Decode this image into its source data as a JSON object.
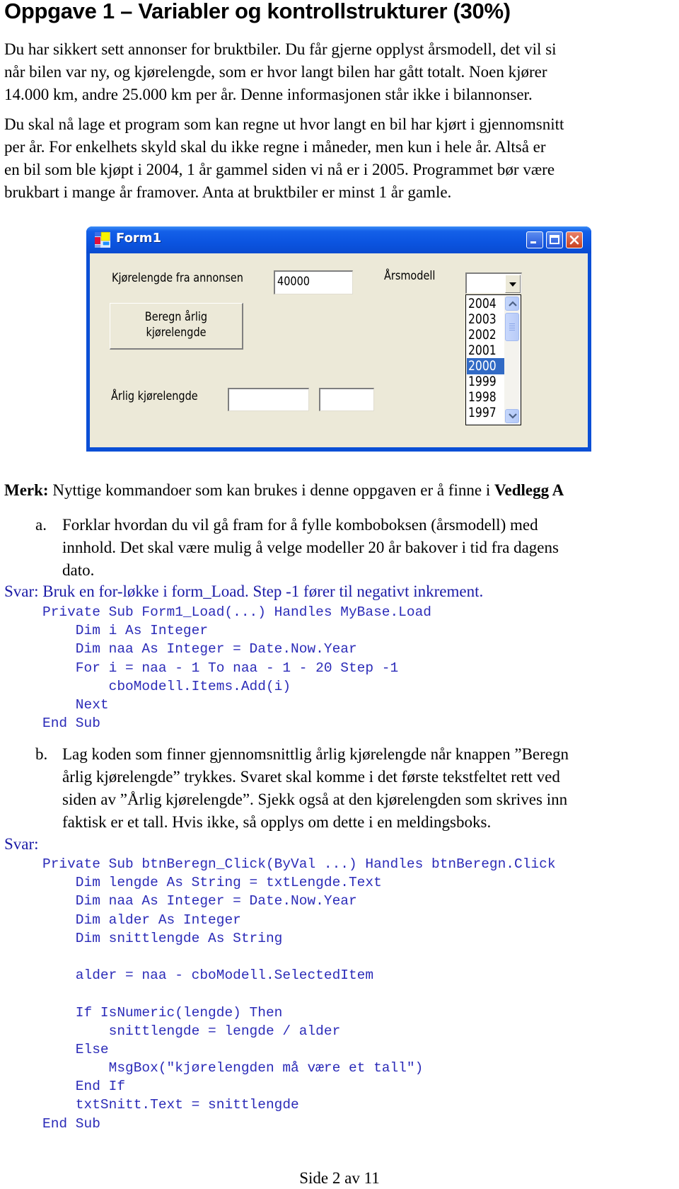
{
  "heading": "Oppgave 1 – Variabler og kontrollstrukturer (30%)",
  "intro": {
    "paragraph1": [
      "Du har sikkert sett annonser for bruktbiler. Du får gjerne opplyst årsmodell, det vil si",
      "når bilen var ny, og kjørelengde, som er hvor langt bilen har gått totalt. Noen kjører",
      "14.000 km, andre 25.000 km per år. Denne informasjonen står ikke i bilannonser."
    ],
    "paragraph2": [
      "Du skal nå lage et program som kan regne ut hvor langt en bil har kjørt i gjennomsnitt",
      "per år. For enkelhets skyld skal du ikke regne i måneder, men kun i hele år. Altså er",
      "en bil som ble kjøpt i 2004, 1 år gammel siden vi nå er i 2005. Programmet bør være",
      "brukbart i mange år framover. Anta at bruktbiler er minst 1 år gamle."
    ]
  },
  "form": {
    "title": "Form1",
    "mileage_label": "Kjørelengde fra annonsen",
    "mileage_value": "40000",
    "model_label": "Årsmodell",
    "model_combo_value": "",
    "calc_button_lines": [
      "Beregn årlig",
      "kjørelengde"
    ],
    "annual_label": "Årlig kjørelengde",
    "annual_value_1": "",
    "annual_value_2": "",
    "year_list": [
      "2004",
      "2003",
      "2002",
      "2001",
      "2000",
      "1999",
      "1998",
      "1997"
    ],
    "selected_year": "2000",
    "colors": {
      "titlebar": "#0b54e0",
      "client_bg": "#ece9d8",
      "selection": "#316ac5"
    }
  },
  "note": {
    "prefix": "Merk:",
    "text": " Nyttige kommandoer som kan brukes i denne oppgaven er å finne i ",
    "ref": "Vedlegg A"
  },
  "task_a": {
    "marker": "a.",
    "lines": [
      "Forklar hvordan du vil gå fram for å fylle komboboksen (årsmodell) med",
      "innhold. Det skal være mulig å velge modeller 20 år bakover i tid fra dagens",
      "dato."
    ],
    "answer": "Svar: Bruk en for-løkke i form_Load. Step -1 fører til negativt inkrement.",
    "code": [
      "Private Sub Form1_Load(...) Handles MyBase.Load",
      "    Dim i As Integer",
      "    Dim naa As Integer = Date.Now.Year",
      "    For i = naa - 1 To naa - 1 - 20 Step -1",
      "        cboModell.Items.Add(i)",
      "    Next",
      "End Sub"
    ]
  },
  "task_b": {
    "marker": "b.",
    "lines": [
      "Lag koden som finner gjennomsnittlig årlig kjørelengde når knappen ”Beregn",
      "årlig kjørelengde” trykkes. Svaret skal komme i det første tekstfeltet rett ved",
      "siden av ”Årlig kjørelengde”. Sjekk også at den kjørelengden som skrives inn",
      "faktisk er et tall. Hvis ikke, så opplys om dette i en meldingsboks."
    ],
    "answer": "Svar:",
    "code": [
      "Private Sub btnBeregn_Click(ByVal ...) Handles btnBeregn.Click",
      "    Dim lengde As String = txtLengde.Text",
      "    Dim naa As Integer = Date.Now.Year",
      "    Dim alder As Integer",
      "    Dim snittlengde As String",
      "",
      "    alder = naa - cboModell.SelectedItem",
      "",
      "    If IsNumeric(lengde) Then",
      "        snittlengde = lengde / alder",
      "    Else",
      "        MsgBox(\"kjørelengden må være et tall\")",
      "    End If",
      "    txtSnitt.Text = snittlengde",
      "End Sub"
    ]
  },
  "footer": "Side 2 av 11"
}
